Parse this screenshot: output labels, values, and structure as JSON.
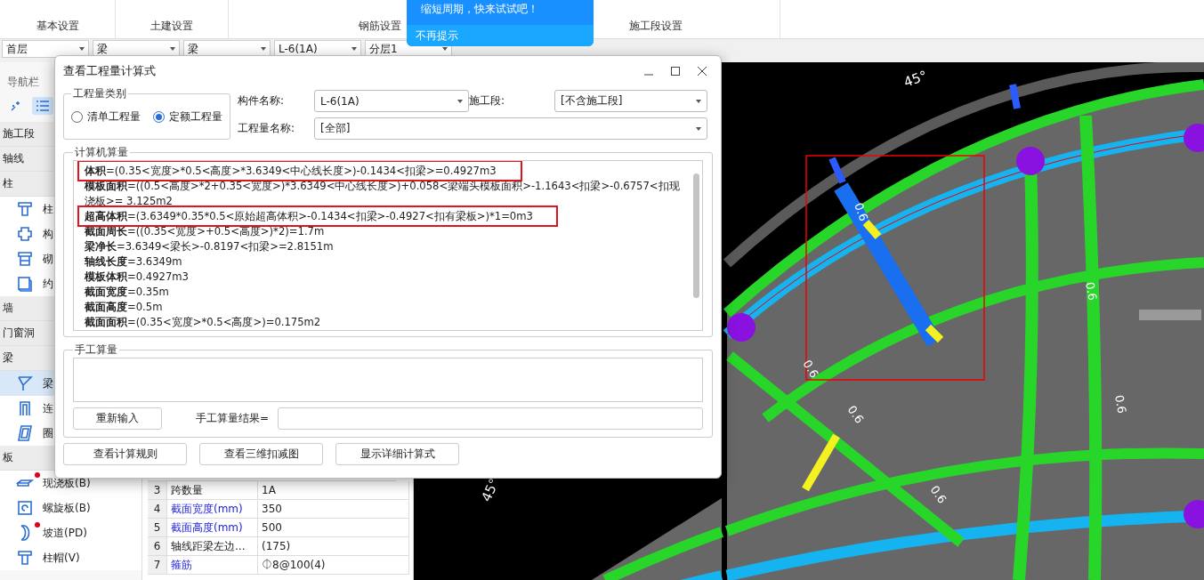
{
  "ribbon": {
    "groups": [
      "基本设置",
      "土建设置",
      "钢筋设置",
      "施工段设置"
    ]
  },
  "tip": {
    "message": "缩短周期，快来试试吧！",
    "dismiss": "不再提示"
  },
  "selectors": [
    "首层",
    "梁",
    "梁",
    "L-6(1A)",
    "分层1"
  ],
  "nav": {
    "title": "导航栏",
    "entries": [
      {
        "kind": "section",
        "label": "施工段"
      },
      {
        "kind": "section",
        "label": "轴线"
      },
      {
        "kind": "section",
        "label": "柱"
      },
      {
        "kind": "item",
        "label": "柱",
        "selected": false,
        "marked": false
      },
      {
        "kind": "item",
        "label": "构",
        "selected": false,
        "marked": false
      },
      {
        "kind": "item",
        "label": "砌",
        "selected": false,
        "marked": false
      },
      {
        "kind": "item",
        "label": "约",
        "selected": false,
        "marked": false
      },
      {
        "kind": "section",
        "label": "墙"
      },
      {
        "kind": "section",
        "label": "门窗洞"
      },
      {
        "kind": "section",
        "label": "梁"
      },
      {
        "kind": "item",
        "label": "梁",
        "selected": true,
        "marked": false
      },
      {
        "kind": "item",
        "label": "连",
        "selected": false,
        "marked": false
      },
      {
        "kind": "item",
        "label": "圈",
        "selected": false,
        "marked": false
      },
      {
        "kind": "section",
        "label": "板"
      },
      {
        "kind": "item",
        "label": "现浇板(B)",
        "selected": false,
        "marked": true
      },
      {
        "kind": "item",
        "label": "螺旋板(B)",
        "selected": false,
        "marked": false
      },
      {
        "kind": "item",
        "label": "坡道(PD)",
        "selected": false,
        "marked": true
      },
      {
        "kind": "item",
        "label": "柱帽(V)",
        "selected": false,
        "marked": false
      }
    ]
  },
  "properties": [
    {
      "index": "3",
      "name": "跨数量",
      "value": "1A",
      "public": false
    },
    {
      "index": "4",
      "name": "截面宽度(mm)",
      "value": "350",
      "public": true
    },
    {
      "index": "5",
      "name": "截面高度(mm)",
      "value": "500",
      "public": true
    },
    {
      "index": "6",
      "name": "轴线距梁左边...",
      "value": "(175)",
      "public": false
    },
    {
      "index": "7",
      "name": "箍筋",
      "value": "⏀8@100(4)",
      "public": true
    }
  ],
  "canvas": {
    "angle_labels": [
      "45°",
      "45°"
    ],
    "segment_labels": [
      "0.6",
      "0.6",
      "0.6",
      "0.6",
      "0.6",
      "0.6"
    ]
  },
  "dialog": {
    "title": "查看工程量计算式",
    "category": {
      "legend": "工程量类别",
      "options": [
        {
          "label": "清单工程量",
          "selected": false
        },
        {
          "label": "定额工程量",
          "selected": true
        }
      ]
    },
    "fields": [
      {
        "label": "构件名称:",
        "value": "L-6(1A)"
      },
      {
        "label": "施工段:",
        "value": "[不含施工段]"
      },
      {
        "label": "工程量名称:",
        "value": "[全部]"
      }
    ],
    "computed": {
      "legend": "计算机算量",
      "lines": [
        {
          "name": "体积",
          "formula": "=(0.35<宽度>*0.5<高度>*3.6349<中心线长度>)-0.1434<扣梁>=0.4927m3",
          "highlighted": true
        },
        {
          "name": "模板面积",
          "formula": "=((0.5<高度>*2+0.35<宽度>)*3.6349<中心线长度>)+0.058<梁端头模板面积>-1.1643<扣梁>-0.6757<扣现浇板>= 3.125m2",
          "highlighted": false
        },
        {
          "name": "超高体积",
          "formula": "=(3.6349*0.35*0.5<原始超高体积>-0.1434<扣梁>-0.4927<扣有梁板>)*1=0m3",
          "highlighted": true
        },
        {
          "name": "截面周长",
          "formula": "=((0.35<宽度>+0.5<高度>)*2)=1.7m",
          "highlighted": false
        },
        {
          "name": "梁净长",
          "formula": "=3.6349<梁长>-0.8197<扣梁>=2.8151m",
          "highlighted": false
        },
        {
          "name": "轴线长度",
          "formula": "=3.6349m",
          "highlighted": false
        },
        {
          "name": "模板体积",
          "formula": "=0.4927m3",
          "highlighted": false
        },
        {
          "name": "截面宽度",
          "formula": "=0.35m",
          "highlighted": false
        },
        {
          "name": "截面高度",
          "formula": "=0.5m",
          "highlighted": false
        },
        {
          "name": "截面面积",
          "formula": "=(0.35<宽度>*0.5<高度>)=0.175m2",
          "highlighted": false
        }
      ]
    },
    "manual": {
      "legend": "手工算量",
      "reset": "重新输入",
      "result_label": "手工算量结果="
    },
    "buttons": [
      "查看计算规则",
      "查看三维扣减图",
      "显示详细计算式"
    ]
  }
}
